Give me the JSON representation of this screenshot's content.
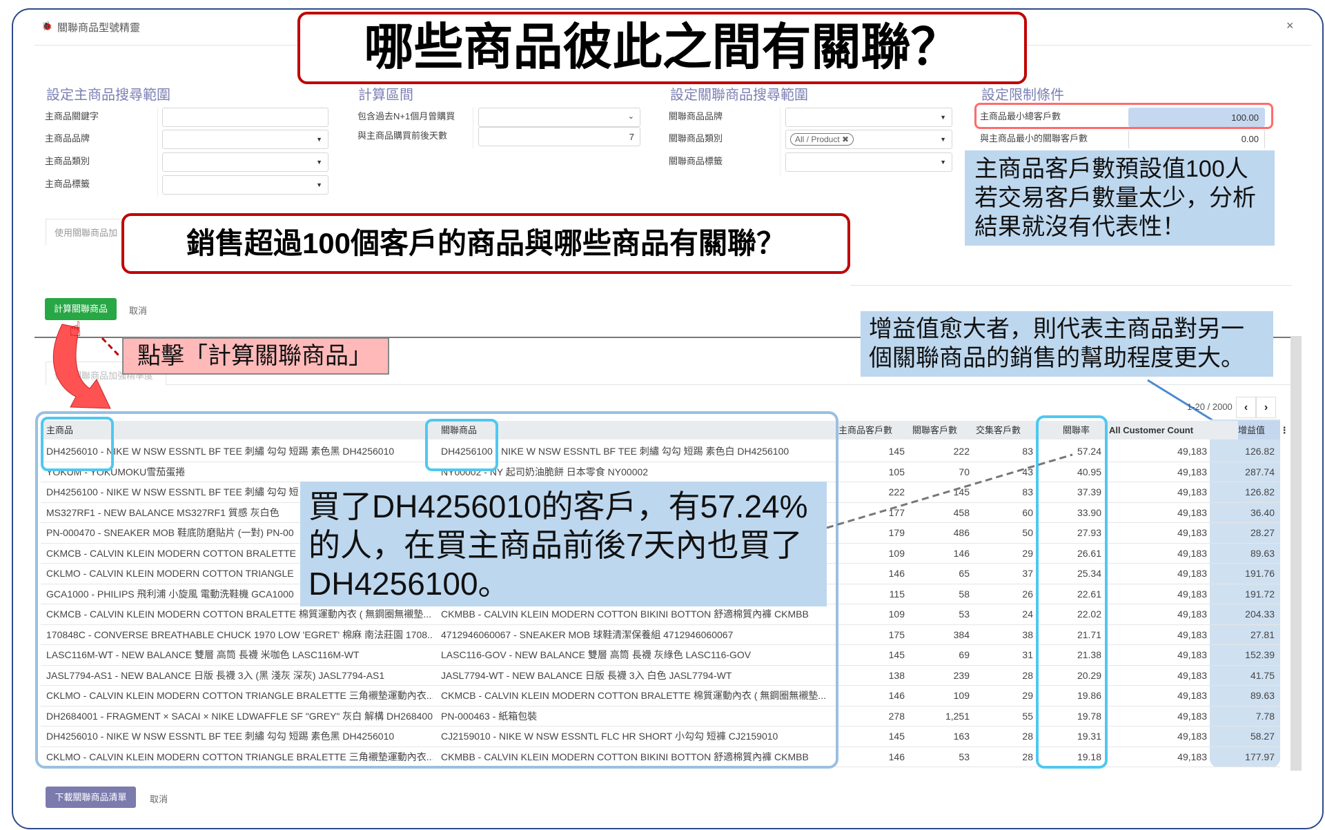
{
  "window": {
    "title": "關聯商品型號精靈",
    "icon": "bug-icon",
    "close": "×"
  },
  "callouts": {
    "main_question": "哪些商品彼此之間有關聯？",
    "sub_question": "銷售超過100個客戶的商品與哪些商品有關聯？",
    "min_customers_note": "主商品客戶數預設值100人若交易客戶數量太少，分析結果就沒有代表性！",
    "click_hint": "點擊「計算關聯商品」",
    "lift_note": "增益值愈大者，則代表主商品對另一個關聯商品的銷售的幫助程度更大。",
    "example_note": "買了DH4256010的客戶，有57.24%的人，在買主商品前後7天內也買了DH4256100。"
  },
  "form": {
    "main_scope": {
      "heading": "設定主商品搜尋範圍",
      "fields": [
        {
          "label": "主商品關鍵字",
          "value": ""
        },
        {
          "label": "主商品品牌",
          "value": ""
        },
        {
          "label": "主商品類別",
          "value": ""
        },
        {
          "label": "主商品標籤",
          "value": ""
        }
      ]
    },
    "period": {
      "heading": "計算區間",
      "fields": [
        {
          "label": "包含過去N+1個月曾購買",
          "value": ""
        },
        {
          "label": "與主商品購買前後天數",
          "value": "7"
        }
      ]
    },
    "related_scope": {
      "heading": "設定關聯商品搜尋範圍",
      "fields": [
        {
          "label": "關聯商品品牌",
          "value": ""
        },
        {
          "label": "關聯商品類別",
          "value": "All / Product"
        },
        {
          "label": "關聯商品標籤",
          "value": ""
        }
      ]
    },
    "limits": {
      "heading": "設定限制條件",
      "fields": [
        {
          "label": "主商品最小總客戶數",
          "value": "100.00"
        },
        {
          "label": "與主商品最小的關聯客戶數",
          "value": "0.00"
        }
      ]
    },
    "tab_top": "使用關聯商品加",
    "compute_button": "計算關聯商品",
    "cancel": "取消"
  },
  "results": {
    "tab": "使用關聯商品加強精準度",
    "pager": "1-20 / 2000",
    "columns": [
      "主商品",
      "關聯商品",
      "主商品客戶數",
      "關聯客戶數",
      "交集客戶數",
      "關聯率",
      "All Customer Count",
      "增益值"
    ],
    "rows": [
      [
        "DH4256010 - NIKE W NSW ESSNTL BF TEE 刺繡 勾勾 短踢 素色黑 DH4256010",
        "DH4256100 - NIKE W NSW ESSNTL BF TEE 刺繡 勾勾 短踢 素色白 DH4256100",
        "145",
        "222",
        "83",
        "57.24",
        "49,183",
        "126.82"
      ],
      [
        "YOKUM - YOKUMOKU雪茄蛋捲",
        "NY00002 - NY 起司奶油脆餅 日本零食 NY00002",
        "105",
        "70",
        "43",
        "40.95",
        "49,183",
        "287.74"
      ],
      [
        "DH4256100 - NIKE W NSW ESSNTL BF TEE 刺繡 勾勾 短",
        "",
        "222",
        "145",
        "83",
        "37.39",
        "49,183",
        "126.82"
      ],
      [
        "MS327RF1 - NEW BALANCE MS327RF1 質感 灰白色",
        "",
        "177",
        "458",
        "60",
        "33.90",
        "49,183",
        "36.40"
      ],
      [
        "PN-000470 - SNEAKER MOB 鞋底防磨貼片 (一對) PN-00",
        "",
        "179",
        "486",
        "50",
        "27.93",
        "49,183",
        "28.27"
      ],
      [
        "CKMCB - CALVIN KLEIN MODERN COTTON BRALETTE",
        "",
        "109",
        "146",
        "29",
        "26.61",
        "49,183",
        "89.63"
      ],
      [
        "CKLMO - CALVIN KLEIN MODERN COTTON TRIANGLE",
        "",
        "146",
        "65",
        "37",
        "25.34",
        "49,183",
        "191.76"
      ],
      [
        "GCA1000 - PHILIPS 飛利浦 小旋風 電動洗鞋機 GCA1000",
        "",
        "115",
        "58",
        "26",
        "22.61",
        "49,183",
        "191.72"
      ],
      [
        "CKMCB - CALVIN KLEIN MODERN COTTON BRALETTE 棉質運動內衣 ( 無鋼圈無襯墊...",
        "CKMBB - CALVIN KLEIN MODERN COTTON BIKINI BOTTON 舒適棉質內褲 CKMBB",
        "109",
        "53",
        "24",
        "22.02",
        "49,183",
        "204.33"
      ],
      [
        "170848C - CONVERSE BREATHABLE CHUCK 1970 LOW 'EGRET' 棉麻 南法莊園 1708...",
        "4712946060067 - SNEAKER MOB 球鞋清潔保養組 4712946060067",
        "175",
        "384",
        "38",
        "21.71",
        "49,183",
        "27.81"
      ],
      [
        "LASC116M-WT - NEW BALANCE 雙層 高筒 長襪 米咖色 LASC116M-WT",
        "LASC116-GOV - NEW BALANCE 雙層 高筒 長襪 灰綠色 LASC116-GOV",
        "145",
        "69",
        "31",
        "21.38",
        "49,183",
        "152.39"
      ],
      [
        "JASL7794-AS1 - NEW BALANCE 日版 長襪 3入 (黑 淺灰 深灰) JASL7794-AS1",
        "JASL7794-WT - NEW BALANCE 日版 長襪 3入 白色 JASL7794-WT",
        "138",
        "239",
        "28",
        "20.29",
        "49,183",
        "41.75"
      ],
      [
        "CKLMO - CALVIN KLEIN MODERN COTTON TRIANGLE BRALETTE 三角襯墊運動內衣...",
        "CKMCB - CALVIN KLEIN MODERN COTTON BRALETTE 棉質運動內衣 ( 無鋼圈無襯墊...",
        "146",
        "109",
        "29",
        "19.86",
        "49,183",
        "89.63"
      ],
      [
        "DH2684001 - FRAGMENT × SACAI × NIKE LDWAFFLE SF \"GREY\" 灰白 解構 DH2684001",
        "PN-000463 - 紙箱包裝",
        "278",
        "1,251",
        "55",
        "19.78",
        "49,183",
        "7.78"
      ],
      [
        "DH4256010 - NIKE W NSW ESSNTL BF TEE 刺繡 勾勾 短踢 素色黑 DH4256010",
        "CJ2159010 - NIKE W NSW ESSNTL FLC HR SHORT 小勾勾 短褲 CJ2159010",
        "145",
        "163",
        "28",
        "19.31",
        "49,183",
        "58.27"
      ],
      [
        "CKLMO - CALVIN KLEIN MODERN COTTON TRIANGLE BRALETTE 三角襯墊運動內衣...",
        "CKMBB - CALVIN KLEIN MODERN COTTON BIKINI BOTTON 舒適棉質內褲 CKMBB",
        "146",
        "53",
        "28",
        "19.18",
        "49,183",
        "177.97"
      ]
    ],
    "download_button": "下載關聯商品清單",
    "cancel": "取消"
  },
  "colors": {
    "accent_green": "#28a745",
    "download_purple": "#7c7bad",
    "heading": "#7c80b4",
    "callout_red": "#c00000",
    "callout_blue": "#bdd7ee",
    "highlight_cyan": "#4fc8f0"
  }
}
